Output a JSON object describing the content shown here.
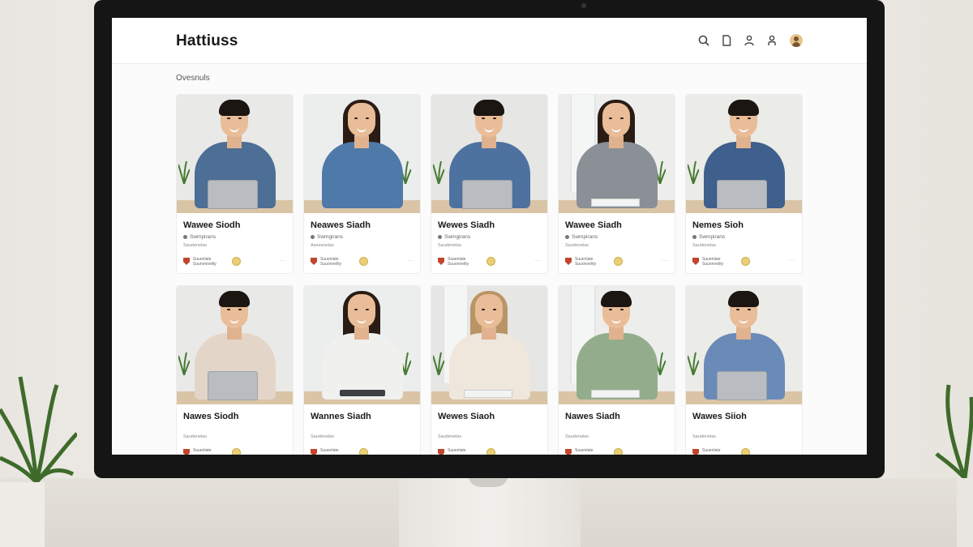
{
  "app": {
    "title": "Hattiuss"
  },
  "header_icons": [
    "search-icon",
    "document-icon",
    "people-icon",
    "user-icon",
    "profile-avatar"
  ],
  "section": {
    "label": "Ovesnuls"
  },
  "cards": [
    {
      "name": "Wawee Siodh",
      "status": "Swmpirans",
      "dept": "Saudenelas",
      "foot": "Suuenlate Suunonnelity",
      "meta": "·····",
      "shirt": "#4d6e95",
      "hair": "short",
      "prop": "laptop"
    },
    {
      "name": "Neawes Siadh",
      "status": "Swmgirans",
      "dept": "Aseeanelas",
      "foot": "Suuenlate Suuonnelity",
      "meta": "·····",
      "shirt": "#4f79a8",
      "hair": "long",
      "prop": "phone"
    },
    {
      "name": "Wewes Siadh",
      "status": "Swmgirans",
      "dept": "Saudenelas",
      "foot": "Suaenlate Suuonnelity",
      "meta": "·····",
      "shirt": "#4e72a0",
      "hair": "short",
      "prop": "laptop"
    },
    {
      "name": "Wawee Siadh",
      "status": "Swmpirans",
      "dept": "Saudenelas",
      "foot": "Suuenlate Suuonnelity",
      "meta": "·····",
      "shirt": "#8a9096",
      "hair": "long",
      "prop": "notebook"
    },
    {
      "name": "Nemes Sioh",
      "status": "Swmpirans",
      "dept": "Saudenelas",
      "foot": "Suuenlate Suuonnelity",
      "meta": "·····",
      "shirt": "#3f5f8c",
      "hair": "short",
      "prop": "laptop"
    },
    {
      "name": "Nawes Siodh",
      "status": "",
      "dept": "Saudenelas",
      "foot": "Suuenlate",
      "meta": "",
      "shirt": "#e3d6c8",
      "hair": "short",
      "prop": "laptop"
    },
    {
      "name": "Wannes Siadh",
      "status": "",
      "dept": "Saudenelas",
      "foot": "Suuenlate",
      "meta": "",
      "shirt": "#f0f0ef",
      "hair": "long",
      "prop": "tablet"
    },
    {
      "name": "Wewes Siaoh",
      "status": "",
      "dept": "Saudenelas",
      "foot": "Suuenlate",
      "meta": "",
      "shirt": "#efe6dc",
      "hair": "long-blonde",
      "prop": "notebook"
    },
    {
      "name": "Nawes Siadh",
      "status": "",
      "dept": "Saudenelas",
      "foot": "Suuenlate",
      "meta": "",
      "shirt": "#93ad8c",
      "hair": "short",
      "prop": "notebook"
    },
    {
      "name": "Wawes Siioh",
      "status": "",
      "dept": "Saudenelas",
      "foot": "Suuenlate",
      "meta": "",
      "shirt": "#6a8ab8",
      "hair": "short",
      "prop": "laptop"
    }
  ]
}
